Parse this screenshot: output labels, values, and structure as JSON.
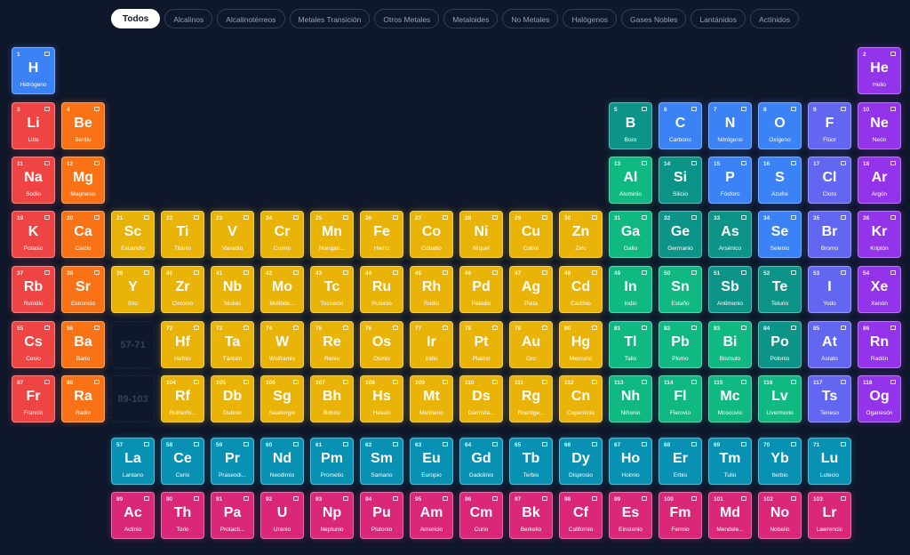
{
  "filters": [
    "Todos",
    "Alcalinos",
    "Alcalinotérreos",
    "Metales Transición",
    "Otros Metales",
    "Metaloides",
    "No Metales",
    "Halógenos",
    "Gases Nobles",
    "Lantánidos",
    "Actínidos"
  ],
  "active_filter": "Todos",
  "colors": {
    "alkali": "#ef4444",
    "alkaline": "#f97316",
    "transition": "#eab308",
    "post": "#10b981",
    "metalloid": "#0d9488",
    "nonmetal": "#3b82f6",
    "halogen": "#6366f1",
    "noble": "#9333ea",
    "lanthanide": "#0891b2",
    "actinide": "#db2777"
  },
  "placeholders": [
    "57-71",
    "89-103"
  ],
  "elements": [
    {
      "n": 1,
      "s": "H",
      "name": "Hidrógeno",
      "cat": "nonmetal"
    },
    {
      "n": 2,
      "s": "He",
      "name": "Helio",
      "cat": "noble"
    },
    {
      "n": 3,
      "s": "Li",
      "name": "Litio",
      "cat": "alkali"
    },
    {
      "n": 4,
      "s": "Be",
      "name": "Berilio",
      "cat": "alkaline"
    },
    {
      "n": 5,
      "s": "B",
      "name": "Boro",
      "cat": "metalloid"
    },
    {
      "n": 6,
      "s": "C",
      "name": "Carbono",
      "cat": "nonmetal"
    },
    {
      "n": 7,
      "s": "N",
      "name": "Nitrógeno",
      "cat": "nonmetal"
    },
    {
      "n": 8,
      "s": "O",
      "name": "Oxígeno",
      "cat": "nonmetal"
    },
    {
      "n": 9,
      "s": "F",
      "name": "Flúor",
      "cat": "halogen"
    },
    {
      "n": 10,
      "s": "Ne",
      "name": "Neón",
      "cat": "noble"
    },
    {
      "n": 11,
      "s": "Na",
      "name": "Sodio",
      "cat": "alkali"
    },
    {
      "n": 12,
      "s": "Mg",
      "name": "Magnesio",
      "cat": "alkaline"
    },
    {
      "n": 13,
      "s": "Al",
      "name": "Aluminio",
      "cat": "post"
    },
    {
      "n": 14,
      "s": "Si",
      "name": "Silicio",
      "cat": "metalloid"
    },
    {
      "n": 15,
      "s": "P",
      "name": "Fósforo",
      "cat": "nonmetal"
    },
    {
      "n": 16,
      "s": "S",
      "name": "Azufre",
      "cat": "nonmetal"
    },
    {
      "n": 17,
      "s": "Cl",
      "name": "Cloro",
      "cat": "halogen"
    },
    {
      "n": 18,
      "s": "Ar",
      "name": "Argón",
      "cat": "noble"
    },
    {
      "n": 19,
      "s": "K",
      "name": "Potasio",
      "cat": "alkali"
    },
    {
      "n": 20,
      "s": "Ca",
      "name": "Calcio",
      "cat": "alkaline"
    },
    {
      "n": 21,
      "s": "Sc",
      "name": "Escandio",
      "cat": "transition"
    },
    {
      "n": 22,
      "s": "Ti",
      "name": "Titanio",
      "cat": "transition"
    },
    {
      "n": 23,
      "s": "V",
      "name": "Vanadio",
      "cat": "transition"
    },
    {
      "n": 24,
      "s": "Cr",
      "name": "Cromo",
      "cat": "transition"
    },
    {
      "n": 25,
      "s": "Mn",
      "name": "Mangan...",
      "cat": "transition"
    },
    {
      "n": 26,
      "s": "Fe",
      "name": "Hierro",
      "cat": "transition"
    },
    {
      "n": 27,
      "s": "Co",
      "name": "Cobalto",
      "cat": "transition"
    },
    {
      "n": 28,
      "s": "Ni",
      "name": "Níquel",
      "cat": "transition"
    },
    {
      "n": 29,
      "s": "Cu",
      "name": "Cobre",
      "cat": "transition"
    },
    {
      "n": 30,
      "s": "Zn",
      "name": "Zinc",
      "cat": "transition"
    },
    {
      "n": 31,
      "s": "Ga",
      "name": "Galio",
      "cat": "post"
    },
    {
      "n": 32,
      "s": "Ge",
      "name": "Germanio",
      "cat": "metalloid"
    },
    {
      "n": 33,
      "s": "As",
      "name": "Arsénico",
      "cat": "metalloid"
    },
    {
      "n": 34,
      "s": "Se",
      "name": "Selenio",
      "cat": "nonmetal"
    },
    {
      "n": 35,
      "s": "Br",
      "name": "Bromo",
      "cat": "halogen"
    },
    {
      "n": 36,
      "s": "Kr",
      "name": "Kriptón",
      "cat": "noble"
    },
    {
      "n": 37,
      "s": "Rb",
      "name": "Rubidio",
      "cat": "alkali"
    },
    {
      "n": 38,
      "s": "Sr",
      "name": "Estroncio",
      "cat": "alkaline"
    },
    {
      "n": 39,
      "s": "Y",
      "name": "Itrio",
      "cat": "transition"
    },
    {
      "n": 40,
      "s": "Zr",
      "name": "Circonio",
      "cat": "transition"
    },
    {
      "n": 41,
      "s": "Nb",
      "name": "Niobio",
      "cat": "transition"
    },
    {
      "n": 42,
      "s": "Mo",
      "name": "Molibde...",
      "cat": "transition"
    },
    {
      "n": 43,
      "s": "Tc",
      "name": "Tecnecio",
      "cat": "transition"
    },
    {
      "n": 44,
      "s": "Ru",
      "name": "Rutenio",
      "cat": "transition"
    },
    {
      "n": 45,
      "s": "Rh",
      "name": "Rodio",
      "cat": "transition"
    },
    {
      "n": 46,
      "s": "Pd",
      "name": "Paladio",
      "cat": "transition"
    },
    {
      "n": 47,
      "s": "Ag",
      "name": "Plata",
      "cat": "transition"
    },
    {
      "n": 48,
      "s": "Cd",
      "name": "Cadmio",
      "cat": "transition"
    },
    {
      "n": 49,
      "s": "In",
      "name": "Indio",
      "cat": "post"
    },
    {
      "n": 50,
      "s": "Sn",
      "name": "Estaño",
      "cat": "post"
    },
    {
      "n": 51,
      "s": "Sb",
      "name": "Antimonio",
      "cat": "metalloid"
    },
    {
      "n": 52,
      "s": "Te",
      "name": "Telurio",
      "cat": "metalloid"
    },
    {
      "n": 53,
      "s": "I",
      "name": "Yodo",
      "cat": "halogen"
    },
    {
      "n": 54,
      "s": "Xe",
      "name": "Xenón",
      "cat": "noble"
    },
    {
      "n": 55,
      "s": "Cs",
      "name": "Cesio",
      "cat": "alkali"
    },
    {
      "n": 56,
      "s": "Ba",
      "name": "Bario",
      "cat": "alkaline"
    },
    {
      "n": 72,
      "s": "Hf",
      "name": "Hafnio",
      "cat": "transition"
    },
    {
      "n": 73,
      "s": "Ta",
      "name": "Tántalo",
      "cat": "transition"
    },
    {
      "n": 74,
      "s": "W",
      "name": "Wolframio",
      "cat": "transition"
    },
    {
      "n": 75,
      "s": "Re",
      "name": "Renio",
      "cat": "transition"
    },
    {
      "n": 76,
      "s": "Os",
      "name": "Osmio",
      "cat": "transition"
    },
    {
      "n": 77,
      "s": "Ir",
      "name": "Iridio",
      "cat": "transition"
    },
    {
      "n": 78,
      "s": "Pt",
      "name": "Platino",
      "cat": "transition"
    },
    {
      "n": 79,
      "s": "Au",
      "name": "Oro",
      "cat": "transition"
    },
    {
      "n": 80,
      "s": "Hg",
      "name": "Mercurio",
      "cat": "transition"
    },
    {
      "n": 81,
      "s": "Tl",
      "name": "Talio",
      "cat": "post"
    },
    {
      "n": 82,
      "s": "Pb",
      "name": "Plomo",
      "cat": "post"
    },
    {
      "n": 83,
      "s": "Bi",
      "name": "Bismuto",
      "cat": "post"
    },
    {
      "n": 84,
      "s": "Po",
      "name": "Polonio",
      "cat": "metalloid"
    },
    {
      "n": 85,
      "s": "At",
      "name": "Astato",
      "cat": "halogen"
    },
    {
      "n": 86,
      "s": "Rn",
      "name": "Radón",
      "cat": "noble"
    },
    {
      "n": 87,
      "s": "Fr",
      "name": "Francio",
      "cat": "alkali"
    },
    {
      "n": 88,
      "s": "Ra",
      "name": "Radio",
      "cat": "alkaline"
    },
    {
      "n": 104,
      "s": "Rf",
      "name": "Rutherfo...",
      "cat": "transition"
    },
    {
      "n": 105,
      "s": "Db",
      "name": "Dubnio",
      "cat": "transition"
    },
    {
      "n": 106,
      "s": "Sg",
      "name": "Seaborgio",
      "cat": "transition"
    },
    {
      "n": 107,
      "s": "Bh",
      "name": "Bohrio",
      "cat": "transition"
    },
    {
      "n": 108,
      "s": "Hs",
      "name": "Hassio",
      "cat": "transition"
    },
    {
      "n": 109,
      "s": "Mt",
      "name": "Meitnerio",
      "cat": "transition"
    },
    {
      "n": 110,
      "s": "Ds",
      "name": "Darmsta...",
      "cat": "transition"
    },
    {
      "n": 111,
      "s": "Rg",
      "name": "Roentge...",
      "cat": "transition"
    },
    {
      "n": 112,
      "s": "Cn",
      "name": "Copernicio",
      "cat": "transition"
    },
    {
      "n": 113,
      "s": "Nh",
      "name": "Nihonio",
      "cat": "post"
    },
    {
      "n": 114,
      "s": "Fl",
      "name": "Flerovio",
      "cat": "post"
    },
    {
      "n": 115,
      "s": "Mc",
      "name": "Moscovio",
      "cat": "post"
    },
    {
      "n": 116,
      "s": "Lv",
      "name": "Livermorio",
      "cat": "post"
    },
    {
      "n": 117,
      "s": "Ts",
      "name": "Teneso",
      "cat": "halogen"
    },
    {
      "n": 118,
      "s": "Og",
      "name": "Oganesón",
      "cat": "noble"
    },
    {
      "n": 57,
      "s": "La",
      "name": "Lantano",
      "cat": "lanthanide"
    },
    {
      "n": 58,
      "s": "Ce",
      "name": "Cerio",
      "cat": "lanthanide"
    },
    {
      "n": 59,
      "s": "Pr",
      "name": "Praseodi...",
      "cat": "lanthanide"
    },
    {
      "n": 60,
      "s": "Nd",
      "name": "Neodimio",
      "cat": "lanthanide"
    },
    {
      "n": 61,
      "s": "Pm",
      "name": "Prometio",
      "cat": "lanthanide"
    },
    {
      "n": 62,
      "s": "Sm",
      "name": "Samario",
      "cat": "lanthanide"
    },
    {
      "n": 63,
      "s": "Eu",
      "name": "Europio",
      "cat": "lanthanide"
    },
    {
      "n": 64,
      "s": "Gd",
      "name": "Gadolinio",
      "cat": "lanthanide"
    },
    {
      "n": 65,
      "s": "Tb",
      "name": "Terbio",
      "cat": "lanthanide"
    },
    {
      "n": 66,
      "s": "Dy",
      "name": "Disprosio",
      "cat": "lanthanide"
    },
    {
      "n": 67,
      "s": "Ho",
      "name": "Holmio",
      "cat": "lanthanide"
    },
    {
      "n": 68,
      "s": "Er",
      "name": "Erbio",
      "cat": "lanthanide"
    },
    {
      "n": 69,
      "s": "Tm",
      "name": "Tulio",
      "cat": "lanthanide"
    },
    {
      "n": 70,
      "s": "Yb",
      "name": "Iterbio",
      "cat": "lanthanide"
    },
    {
      "n": 71,
      "s": "Lu",
      "name": "Lutecio",
      "cat": "lanthanide"
    },
    {
      "n": 89,
      "s": "Ac",
      "name": "Actinio",
      "cat": "actinide"
    },
    {
      "n": 90,
      "s": "Th",
      "name": "Torio",
      "cat": "actinide"
    },
    {
      "n": 91,
      "s": "Pa",
      "name": "Protacti...",
      "cat": "actinide"
    },
    {
      "n": 92,
      "s": "U",
      "name": "Uranio",
      "cat": "actinide"
    },
    {
      "n": 93,
      "s": "Np",
      "name": "Neptunio",
      "cat": "actinide"
    },
    {
      "n": 94,
      "s": "Pu",
      "name": "Plutonio",
      "cat": "actinide"
    },
    {
      "n": 95,
      "s": "Am",
      "name": "Americio",
      "cat": "actinide"
    },
    {
      "n": 96,
      "s": "Cm",
      "name": "Curio",
      "cat": "actinide"
    },
    {
      "n": 97,
      "s": "Bk",
      "name": "Berkelio",
      "cat": "actinide"
    },
    {
      "n": 98,
      "s": "Cf",
      "name": "Californio",
      "cat": "actinide"
    },
    {
      "n": 99,
      "s": "Es",
      "name": "Einstenio",
      "cat": "actinide"
    },
    {
      "n": 100,
      "s": "Fm",
      "name": "Fermio",
      "cat": "actinide"
    },
    {
      "n": 101,
      "s": "Md",
      "name": "Mendele...",
      "cat": "actinide"
    },
    {
      "n": 102,
      "s": "No",
      "name": "Nobelio",
      "cat": "actinide"
    },
    {
      "n": 103,
      "s": "Lr",
      "name": "Lawrencio",
      "cat": "actinide"
    }
  ]
}
